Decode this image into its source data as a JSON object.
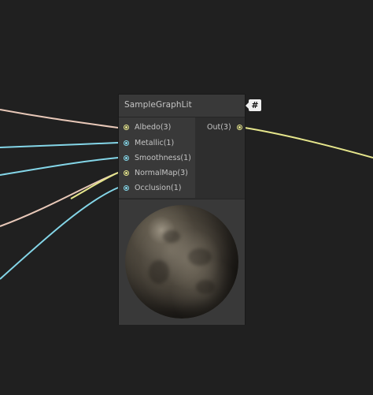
{
  "node": {
    "title": "SampleGraphLit",
    "inputs": [
      {
        "label": "Albedo(3)",
        "color": "#e6e68c"
      },
      {
        "label": "Metallic(1)",
        "color": "#84d6e8"
      },
      {
        "label": "Smoothness(1)",
        "color": "#84d6e8"
      },
      {
        "label": "NormalMap(3)",
        "color": "#e6e68c"
      },
      {
        "label": "Occlusion(1)",
        "color": "#84d6e8"
      }
    ],
    "outputs": [
      {
        "label": "Out(3)",
        "color": "#e6e68c"
      }
    ]
  },
  "badge": {
    "symbol": "#",
    "icon": "hash-icon"
  },
  "wire_colors": {
    "albedo": "#e8c8b8",
    "metallic": "#84d6e8",
    "smoothness": "#84d6e8",
    "normal": "#e6e68c",
    "occlusion": "#84d6e8",
    "out": "#e6e68c"
  }
}
